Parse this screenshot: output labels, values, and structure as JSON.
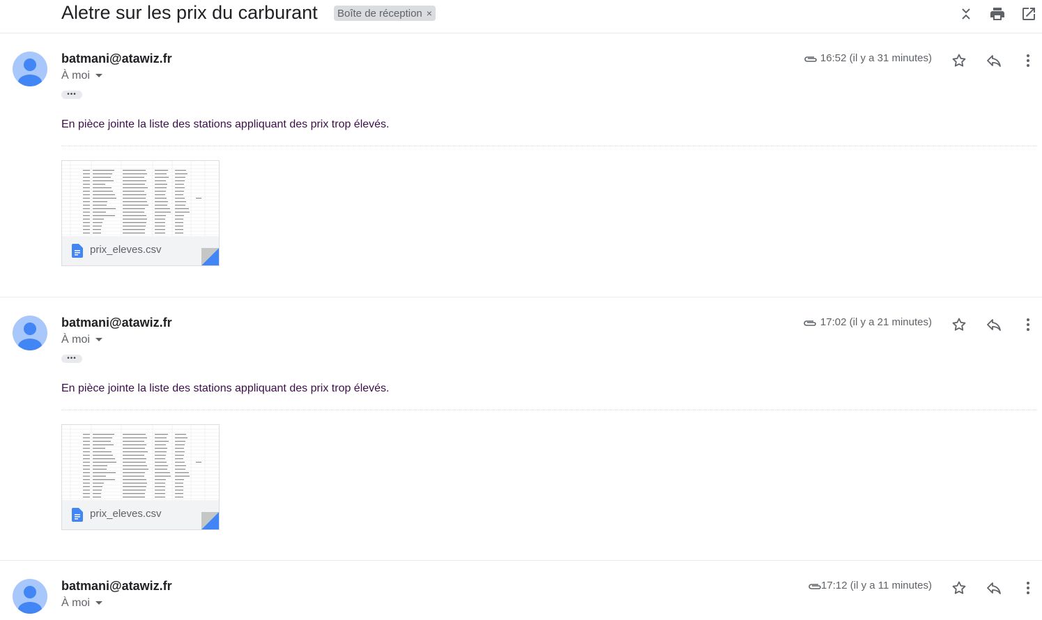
{
  "thread": {
    "subject": "Aletre sur les prix du carburant",
    "label": "Boîte de réception",
    "label_remove": "×"
  },
  "messages": [
    {
      "sender": "batmani@atawiz.fr",
      "recipient": "À moi",
      "time": "16:52 (il y a 31 minutes)",
      "body": "En pièce jointe la liste des stations appliquant des prix trop élevés.",
      "attachment": {
        "filename": "prix_eleves.csv"
      }
    },
    {
      "sender": "batmani@atawiz.fr",
      "recipient": "À moi",
      "time": "17:02 (il y a 21 minutes)",
      "body": "En pièce jointe la liste des stations appliquant des prix trop élevés.",
      "attachment": {
        "filename": "prix_eleves.csv"
      }
    },
    {
      "sender": "batmani@atawiz.fr",
      "recipient": "À moi",
      "time": "17:12 (il y a 11 minutes)"
    }
  ],
  "colors": {
    "avatar_bg": "#a8c7fa",
    "avatar_fg": "#4285f4",
    "body_text": "#3c0f4a",
    "file_icon": "#4285f4"
  }
}
